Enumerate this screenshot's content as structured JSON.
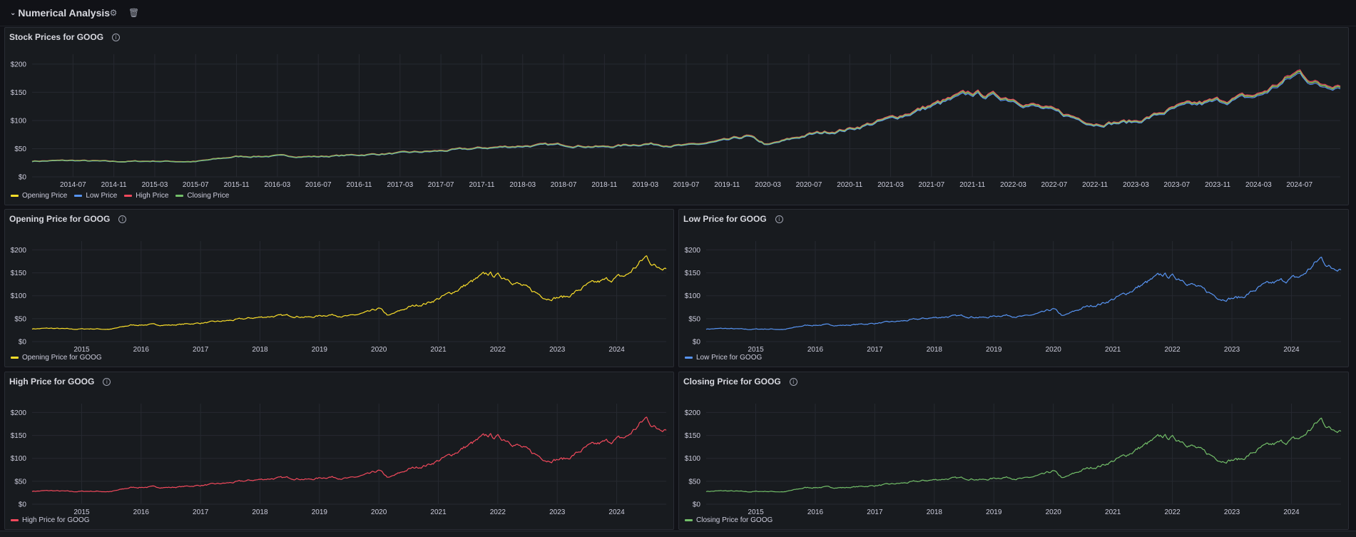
{
  "row": {
    "title": "Numerical Analysis",
    "settings_icon": "gear-icon",
    "delete_icon": "trash-icon"
  },
  "colors": {
    "opening": "#fade2a",
    "low": "#5794f2",
    "high": "#f2495c",
    "closing": "#73bf69",
    "grid": "#262930",
    "bg": "#181b1f"
  },
  "panels": {
    "main": {
      "title": "Stock Prices for GOOG",
      "info_icon": "info-icon",
      "legend": [
        {
          "label": "Opening Price",
          "color": "#fade2a"
        },
        {
          "label": "Low Price",
          "color": "#5794f2"
        },
        {
          "label": "High Price",
          "color": "#f2495c"
        },
        {
          "label": "Closing Price",
          "color": "#73bf69"
        }
      ]
    },
    "opening": {
      "title": "Opening Price for GOOG",
      "info_icon": "info-icon",
      "legend": [
        {
          "label": "Opening Price for GOOG",
          "color": "#fade2a"
        }
      ]
    },
    "low": {
      "title": "Low Price for GOOG",
      "info_icon": "info-icon",
      "legend": [
        {
          "label": "Low Price for GOOG",
          "color": "#5794f2"
        }
      ]
    },
    "high": {
      "title": "High Price for GOOG",
      "info_icon": "info-icon",
      "legend": [
        {
          "label": "High Price for GOOG",
          "color": "#f2495c"
        }
      ]
    },
    "closing": {
      "title": "Closing Price for GOOG",
      "info_icon": "info-icon",
      "legend": [
        {
          "label": "Closing Price for GOOG",
          "color": "#73bf69"
        }
      ]
    }
  },
  "chart_data": [
    {
      "type": "line",
      "title": "Stock Prices for GOOG",
      "y_ticks": [
        "$0",
        "$50",
        "$100",
        "$150",
        "$200"
      ],
      "ylim": [
        0,
        210
      ],
      "xlim": [
        "2014-03",
        "2024-11"
      ],
      "x_ticks": [
        "2014-07",
        "2014-11",
        "2015-03",
        "2015-07",
        "2015-11",
        "2016-03",
        "2016-07",
        "2016-11",
        "2017-03",
        "2017-07",
        "2017-11",
        "2018-03",
        "2018-07",
        "2018-11",
        "2019-03",
        "2019-07",
        "2019-11",
        "2020-03",
        "2020-07",
        "2020-11",
        "2021-03",
        "2021-07",
        "2021-11",
        "2022-03",
        "2022-07",
        "2022-11",
        "2023-03",
        "2023-07",
        "2023-11",
        "2024-03",
        "2024-07"
      ],
      "grid": true,
      "legend": "bottom-left",
      "series": [
        {
          "name": "Opening Price",
          "color": "#fade2a"
        },
        {
          "name": "Low Price",
          "color": "#5794f2"
        },
        {
          "name": "High Price",
          "color": "#f2495c"
        },
        {
          "name": "Closing Price",
          "color": "#73bf69"
        }
      ],
      "x": [
        "2014-03",
        "2014-07",
        "2014-11",
        "2015-03",
        "2015-07",
        "2015-11",
        "2016-03",
        "2016-07",
        "2016-11",
        "2017-03",
        "2017-07",
        "2017-11",
        "2018-03",
        "2018-07",
        "2018-11",
        "2019-03",
        "2019-07",
        "2019-11",
        "2020-01",
        "2020-03",
        "2020-07",
        "2020-11",
        "2021-03",
        "2021-07",
        "2021-11",
        "2022-03",
        "2022-07",
        "2022-11",
        "2023-03",
        "2023-07",
        "2023-11",
        "2024-03",
        "2024-07",
        "2024-09",
        "2024-11"
      ],
      "values": [
        28,
        29,
        27,
        28,
        27,
        36,
        37,
        36,
        39,
        42,
        46,
        51,
        55,
        57,
        53,
        59,
        55,
        64,
        72,
        56,
        75,
        85,
        103,
        126,
        148,
        139,
        115,
        95,
        98,
        122,
        134,
        144,
        185,
        162,
        167
      ]
    },
    {
      "type": "line",
      "title": "Opening Price for GOOG",
      "y_ticks": [
        "$0",
        "$50",
        "$100",
        "$150",
        "$200"
      ],
      "ylim": [
        0,
        210
      ],
      "xlim": [
        "2014-03",
        "2024-11"
      ],
      "x_ticks": [
        "2015",
        "2016",
        "2017",
        "2018",
        "2019",
        "2020",
        "2021",
        "2022",
        "2023",
        "2024"
      ],
      "grid": true,
      "legend": "bottom-left",
      "series": [
        {
          "name": "Opening Price for GOOG",
          "color": "#fade2a"
        }
      ]
    },
    {
      "type": "line",
      "title": "Low Price for GOOG",
      "y_ticks": [
        "$0",
        "$50",
        "$100",
        "$150",
        "$200"
      ],
      "ylim": [
        0,
        210
      ],
      "xlim": [
        "2014-03",
        "2024-11"
      ],
      "x_ticks": [
        "2015",
        "2016",
        "2017",
        "2018",
        "2019",
        "2020",
        "2021",
        "2022",
        "2023",
        "2024"
      ],
      "grid": true,
      "legend": "bottom-left",
      "series": [
        {
          "name": "Low Price for GOOG",
          "color": "#5794f2"
        }
      ]
    },
    {
      "type": "line",
      "title": "High Price for GOOG",
      "y_ticks": [
        "$0",
        "$50",
        "$100",
        "$150",
        "$200"
      ],
      "ylim": [
        0,
        210
      ],
      "xlim": [
        "2014-03",
        "2024-11"
      ],
      "x_ticks": [
        "2015",
        "2016",
        "2017",
        "2018",
        "2019",
        "2020",
        "2021",
        "2022",
        "2023",
        "2024"
      ],
      "grid": true,
      "legend": "bottom-left",
      "series": [
        {
          "name": "High Price for GOOG",
          "color": "#f2495c"
        }
      ]
    },
    {
      "type": "line",
      "title": "Closing Price for GOOG",
      "y_ticks": [
        "$0",
        "$50",
        "$100",
        "$150",
        "$200"
      ],
      "ylim": [
        0,
        210
      ],
      "xlim": [
        "2014-03",
        "2024-11"
      ],
      "x_ticks": [
        "2015",
        "2016",
        "2017",
        "2018",
        "2019",
        "2020",
        "2021",
        "2022",
        "2023",
        "2024"
      ],
      "grid": true,
      "legend": "bottom-left",
      "series": [
        {
          "name": "Closing Price for GOOG",
          "color": "#73bf69"
        }
      ]
    }
  ]
}
